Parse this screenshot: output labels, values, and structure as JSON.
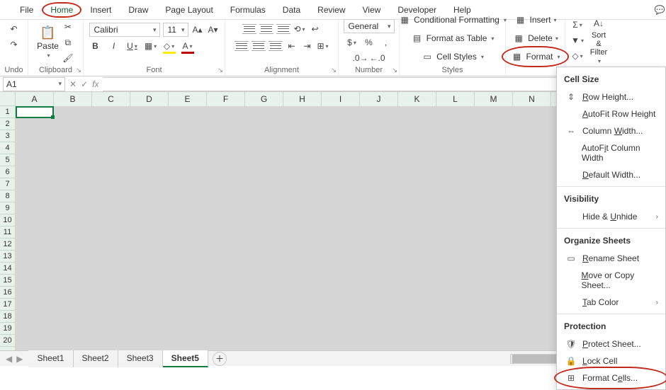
{
  "tabs": {
    "file": "File",
    "home": "Home",
    "insert": "Insert",
    "draw": "Draw",
    "pagelayout": "Page Layout",
    "formulas": "Formulas",
    "data": "Data",
    "review": "Review",
    "view": "View",
    "developer": "Developer",
    "help": "Help"
  },
  "undo_label": "Undo",
  "clipboard": {
    "paste": "Paste",
    "label": "Clipboard"
  },
  "font": {
    "name": "Calibri",
    "size": "11",
    "label": "Font"
  },
  "alignment": {
    "label": "Alignment"
  },
  "number": {
    "format": "General",
    "label": "Number"
  },
  "styles": {
    "cond": "Conditional Formatting",
    "table": "Format as Table",
    "cell": "Cell Styles",
    "label": "Styles"
  },
  "cells": {
    "insert": "Insert",
    "delete": "Delete",
    "format": "Format"
  },
  "editing": {
    "sort": "Sort & Filter"
  },
  "namebox": "A1",
  "cols": [
    "A",
    "B",
    "C",
    "D",
    "E",
    "F",
    "G",
    "H",
    "I",
    "J",
    "K",
    "L",
    "M",
    "N"
  ],
  "rows": [
    "1",
    "2",
    "3",
    "4",
    "5",
    "6",
    "7",
    "8",
    "9",
    "10",
    "11",
    "12",
    "13",
    "14",
    "15",
    "16",
    "17",
    "18",
    "19",
    "20"
  ],
  "sheets": [
    "Sheet1",
    "Sheet2",
    "Sheet3",
    "Sheet5"
  ],
  "dropdown": {
    "cellsize": "Cell Size",
    "rowheight": "Row Height...",
    "autofitrow": "AutoFit Row Height",
    "colwidth": "Column Width...",
    "autofitcol": "AutoFit Column Width",
    "defwidth": "Default Width...",
    "visibility": "Visibility",
    "hideunhide": "Hide & Unhide",
    "organize": "Organize Sheets",
    "rename": "Rename Sheet",
    "movecopy": "Move or Copy Sheet...",
    "tabcolor": "Tab Color",
    "protection": "Protection",
    "protectsheet": "Protect Sheet...",
    "lockcell": "Lock Cell",
    "formatcells": "Format Cells..."
  }
}
